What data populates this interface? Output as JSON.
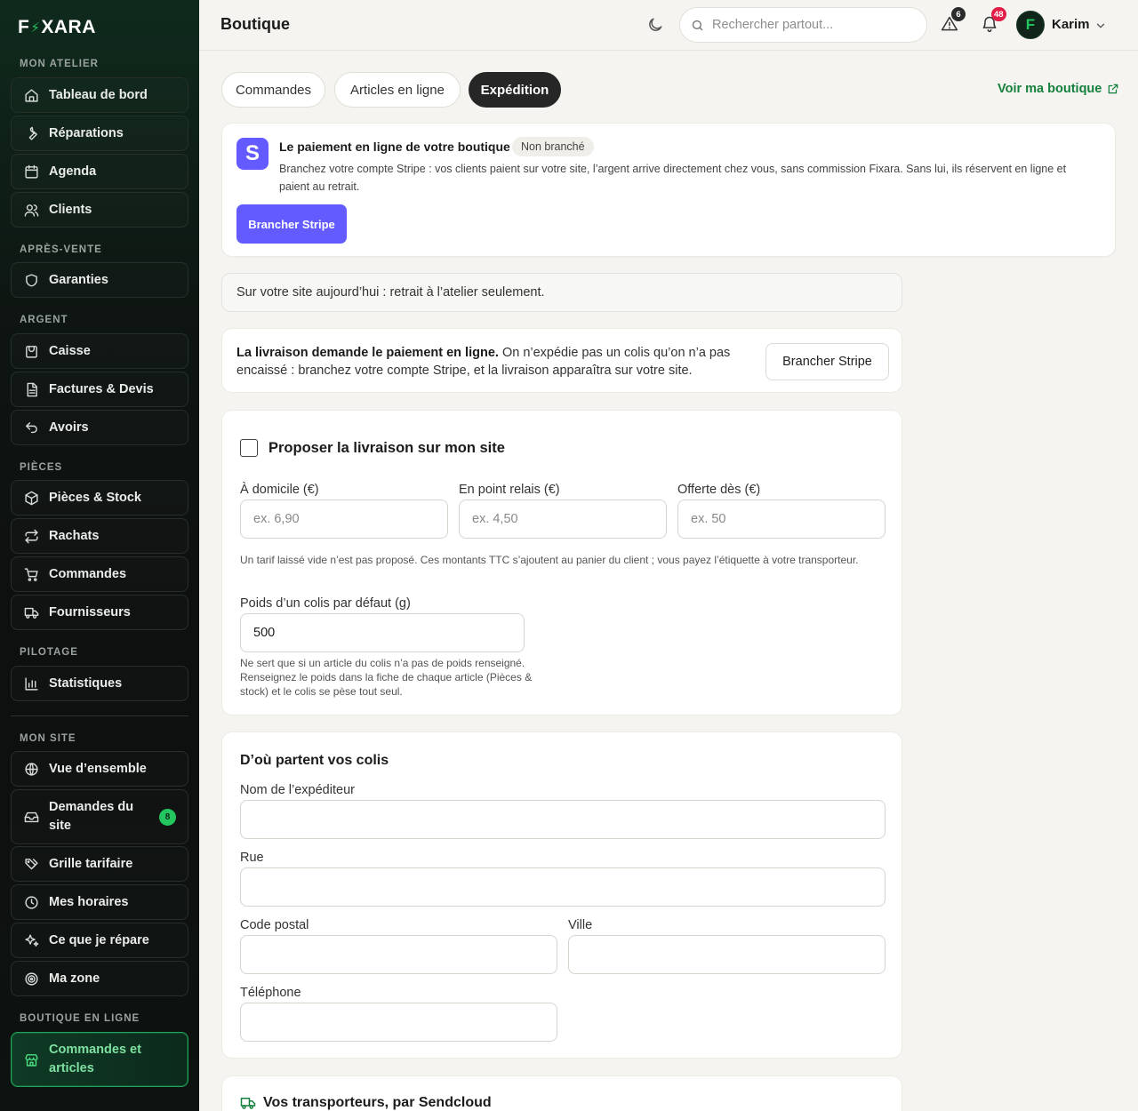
{
  "app": {
    "logo_left": "F",
    "logo_right": "XARA",
    "accent": "#22c55e"
  },
  "sidebar": {
    "sections": {
      "atelier": "MON ATELIER",
      "apres_vente": "APRÈS-VENTE",
      "argent": "ARGENT",
      "pieces": "PIÈCES",
      "pilotage": "PILOTAGE",
      "site": "MON SITE",
      "boutique": "BOUTIQUE EN LIGNE"
    },
    "items": {
      "tableau": {
        "label": "Tableau de bord",
        "icon": "home-icon"
      },
      "reparations": {
        "label": "Réparations",
        "icon": "wrench-icon"
      },
      "agenda": {
        "label": "Agenda",
        "icon": "calendar-icon"
      },
      "clients": {
        "label": "Clients",
        "icon": "users-icon"
      },
      "garanties": {
        "label": "Garanties",
        "icon": "shield-icon"
      },
      "caisse": {
        "label": "Caisse",
        "icon": "register-icon"
      },
      "factures": {
        "label": "Factures & Devis",
        "icon": "document-icon"
      },
      "avoirs": {
        "label": "Avoirs",
        "icon": "undo-icon"
      },
      "pieces": {
        "label": "Pièces & Stock",
        "icon": "box-icon"
      },
      "rachats": {
        "label": "Rachats",
        "icon": "swap-icon"
      },
      "commandes": {
        "label": "Commandes",
        "icon": "cart-icon"
      },
      "fournisseurs": {
        "label": "Fournisseurs",
        "icon": "truck-icon"
      },
      "statistiques": {
        "label": "Statistiques",
        "icon": "chart-icon"
      },
      "vue": {
        "label": "Vue d’ensemble",
        "icon": "globe-icon"
      },
      "demandes": {
        "label": "Demandes du site",
        "icon": "inbox-icon",
        "count": "8"
      },
      "grille": {
        "label": "Grille tarifaire",
        "icon": "tags-icon"
      },
      "horaires": {
        "label": "Mes horaires",
        "icon": "clock-icon"
      },
      "repare": {
        "label": "Ce que je répare",
        "icon": "sparkles-icon"
      },
      "zone": {
        "label": "Ma zone",
        "icon": "target-icon"
      },
      "boutique_cmd": {
        "label": "Commandes et articles",
        "icon": "store-icon"
      }
    }
  },
  "header": {
    "title": "Boutique",
    "search_placeholder": "Rechercher partout...",
    "alerts_count": "6",
    "notifications_count": "48",
    "avatar_initial": "F",
    "user_name": "Karim"
  },
  "tabs": {
    "commandes": "Commandes",
    "articles": "Articles en ligne",
    "expedition": "Expédition",
    "shop_link": "Voir ma boutique"
  },
  "stripe": {
    "logo": "S",
    "title": "Le paiement en ligne de votre boutique",
    "status": "Non branché",
    "description": "Branchez votre compte Stripe : vos clients paient sur votre site, l’argent arrive directement chez vous, sans commission Fixara. Sans lui, ils réservent en ligne et paient au retrait.",
    "button": "Brancher Stripe",
    "brand_color": "#635bff"
  },
  "info_bar": "Sur votre site aujourd’hui : retrait à l’atelier seulement.",
  "shipping_note": {
    "bold": "La livraison demande le paiement en ligne.",
    "text": " On n’expédie pas un colis qu’on n’a pas encaissé : branchez votre compte Stripe, et la livraison apparaîtra sur votre site.",
    "button": "Brancher Stripe"
  },
  "delivery": {
    "checkbox_label": "Proposer la livraison sur mon site",
    "checked": false,
    "home_label": "À domicile (€)",
    "home_placeholder": "ex. 6,90",
    "relay_label": "En point relais (€)",
    "relay_placeholder": "ex. 4,50",
    "free_label": "Offerte dès (€)",
    "free_placeholder": "ex. 50",
    "rates_hint": "Un tarif laissé vide n’est pas proposé. Ces montants TTC s’ajoutent au panier du client ; vous payez l’étiquette à votre transporteur.",
    "weight_label": "Poids d’un colis par défaut (g)",
    "weight_value": "500",
    "weight_hint": "Ne sert que si un article du colis n’a pas de poids renseigné. Renseignez le poids dans la fiche de chaque article (Pièces & stock) et le colis se pèse tout seul."
  },
  "origin": {
    "title": "D’où partent vos colis",
    "sender_label": "Nom de l’expéditeur",
    "street_label": "Rue",
    "postal_label": "Code postal",
    "city_label": "Ville",
    "phone_label": "Téléphone"
  },
  "carriers": {
    "title": "Vos transporteurs, par Sendcloud"
  }
}
